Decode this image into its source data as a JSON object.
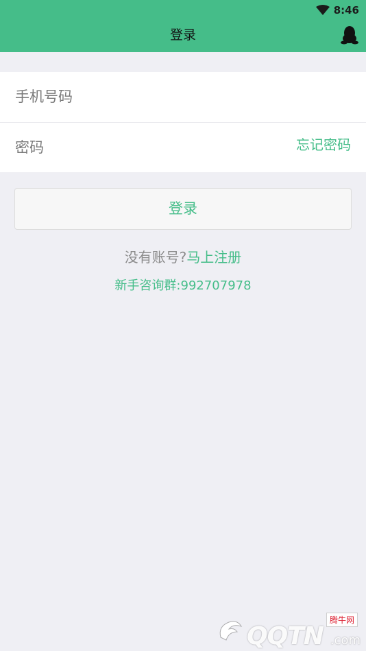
{
  "status_bar": {
    "time": "8:46",
    "wifi_icon": "wifi-icon"
  },
  "header": {
    "title": "登录",
    "qq_icon": "qq-penguin-icon",
    "background": "#45bd89"
  },
  "form": {
    "phone_placeholder": "手机号码",
    "password_placeholder": "密码",
    "forgot_label": "忘记密码"
  },
  "login_button_label": "登录",
  "register": {
    "prompt": "没有账号?",
    "link": "马上注册"
  },
  "group": {
    "label": "新手咨询群:",
    "number": "992707978"
  },
  "watermark": {
    "brand": "QQTN",
    "suffix": ".com",
    "badge": "腾牛网"
  },
  "colors": {
    "accent": "#45bd89",
    "page_bg": "#efeff4"
  }
}
